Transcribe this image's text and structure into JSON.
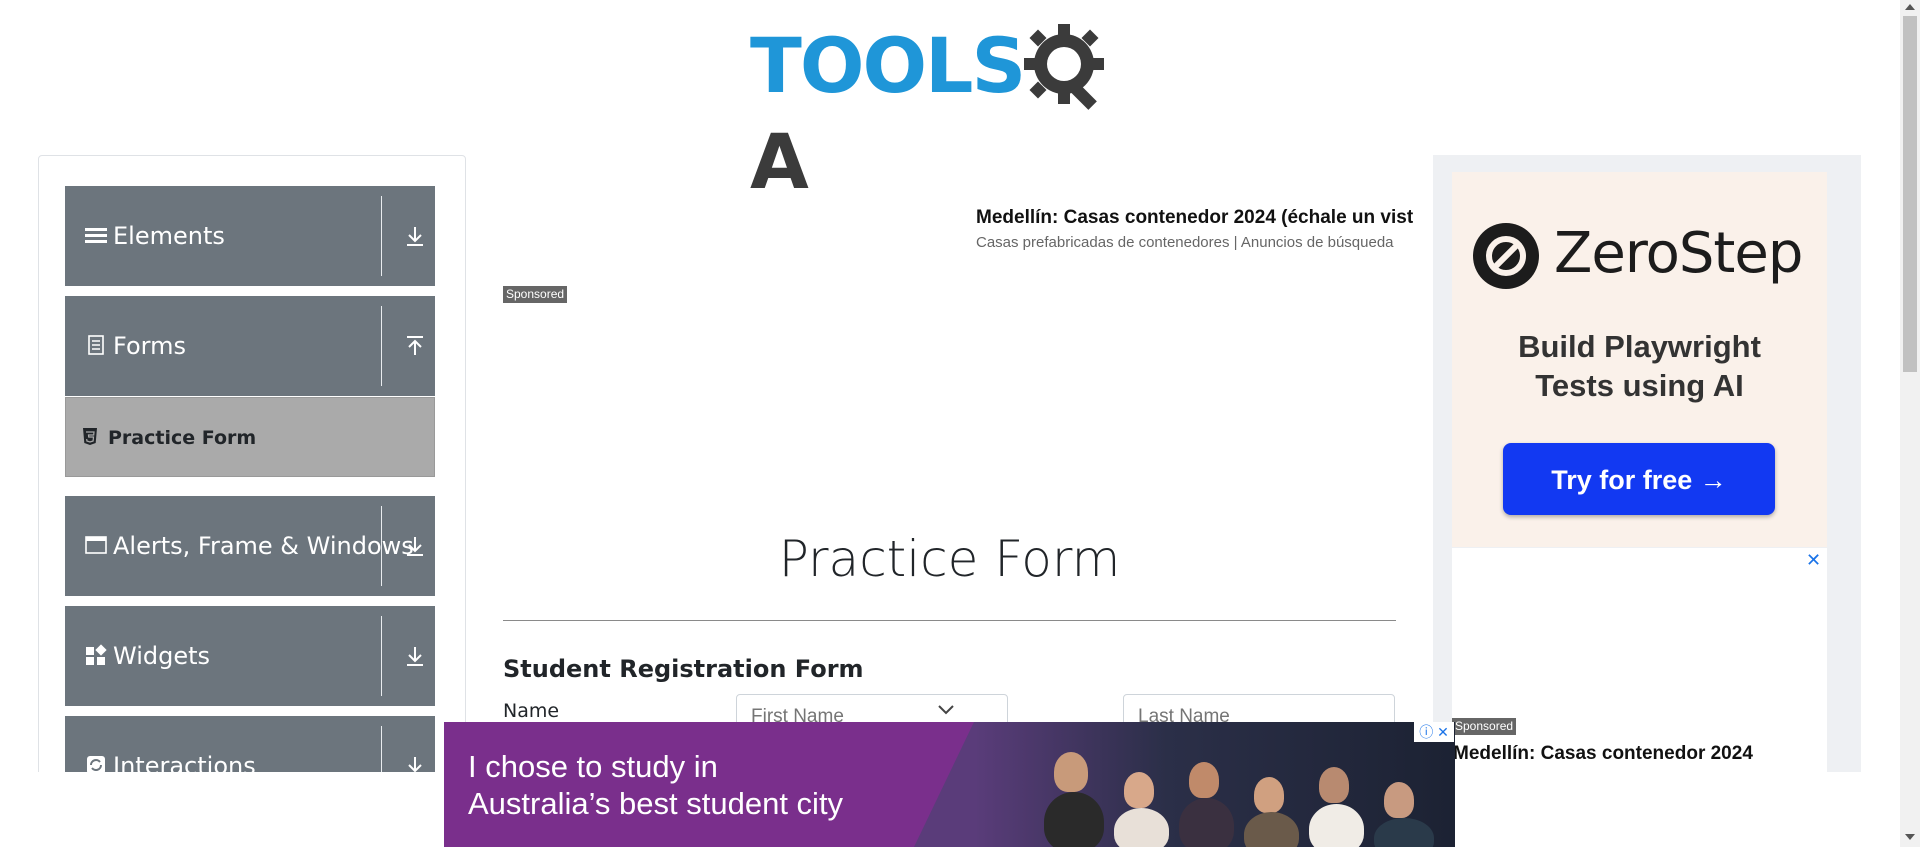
{
  "header": {
    "logo_tools": "TOOLS",
    "logo_qa_suffix": "A"
  },
  "sidebar": {
    "groups": [
      {
        "label": "Elements",
        "icon": "list-icon",
        "arrow": "download-arrow-icon"
      },
      {
        "label": "Forms",
        "icon": "document-icon",
        "arrow": "upload-arrow-icon"
      },
      {
        "label": "Alerts, Frame & Windows",
        "icon": "window-icon",
        "arrow": "download-arrow-icon"
      },
      {
        "label": "Widgets",
        "icon": "widgets-icon",
        "arrow": "download-arrow-icon"
      },
      {
        "label": "Interactions",
        "icon": "refresh-icon",
        "arrow": "download-arrow-icon"
      }
    ],
    "active_item": {
      "label": "Practice Form",
      "icon": "html5-icon"
    }
  },
  "main_ad": {
    "title": "Medellín: Casas contenedor 2024 (échale un vist",
    "subtitle": "Casas prefabricadas de contenedores | Anuncios de búsqueda",
    "sponsored": "Sponsored"
  },
  "form": {
    "title": "Practice Form",
    "subtitle": "Student Registration Form",
    "name_label": "Name",
    "first_name_placeholder": "First Name",
    "last_name_placeholder": "Last Name"
  },
  "right_ad": {
    "brand": "ZeroStep",
    "tagline_line1": "Build Playwright",
    "tagline_line2": "Tests using AI",
    "cta": "Try for free →",
    "close": "✕",
    "sponsored": "Sponsored",
    "title": "Medellín: Casas contenedor 2024"
  },
  "banner_ad": {
    "line1": "I chose to study in",
    "line2": "Australia’s best student city",
    "controls": "ⓘ ✕"
  },
  "colors": {
    "brand_blue": "#1f96d8",
    "sidebar_group": "#6c757d",
    "active_item": "#aaaaaa",
    "cta_blue": "#1239f2",
    "banner_purple": "#7a2f8c"
  }
}
